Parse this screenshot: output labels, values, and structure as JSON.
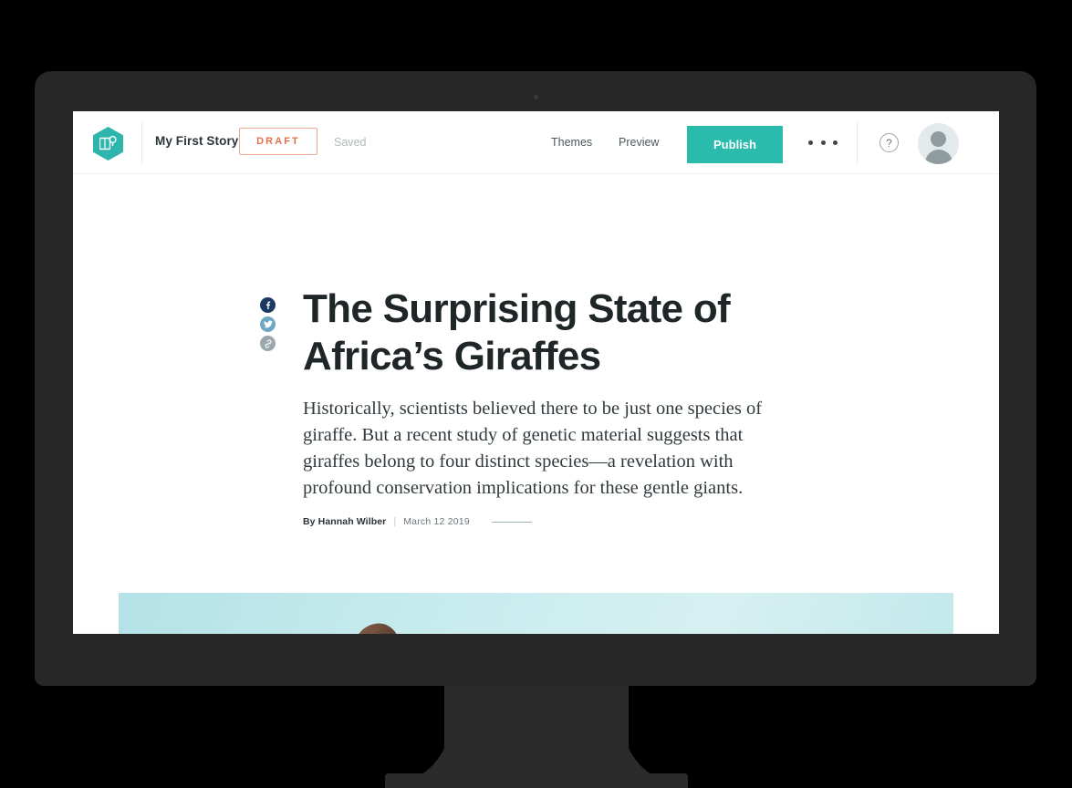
{
  "app": {
    "logo_icon": "storytelling-hexagon-logo",
    "story_title": "My First Story",
    "status_badge": "DRAFT",
    "save_state": "Saved",
    "nav": [
      {
        "label": "Themes",
        "name": "nav-themes"
      },
      {
        "label": "Preview",
        "name": "nav-preview"
      }
    ],
    "publish_label": "Publish",
    "more_menu_icon": "ellipsis-icon",
    "help_icon": "?",
    "avatar_icon": "user-avatar",
    "accent_color": "#2bbbad",
    "draft_color": "#e0714a"
  },
  "article": {
    "share": [
      {
        "name": "share-facebook-button",
        "icon": "facebook-icon",
        "color": "#1b3a63"
      },
      {
        "name": "share-twitter-button",
        "icon": "twitter-icon",
        "color": "#6fa8c4"
      },
      {
        "name": "share-link-button",
        "icon": "link-icon",
        "color": "#9aa7ad"
      }
    ],
    "headline": "The Surprising State of Africa’s Giraffes",
    "standfirst": "Historically, scientists believed there to be just one species of giraffe. But a recent study of genetic material suggests that giraffes belong to four distinct species—a revelation with profound conservation implications for these gentle giants.",
    "byline_author": "By Hannah Wilber",
    "byline_separator": "|",
    "byline_date": "March 12 2019",
    "hero_image_alt": "giraffe head against pale cyan sky"
  }
}
